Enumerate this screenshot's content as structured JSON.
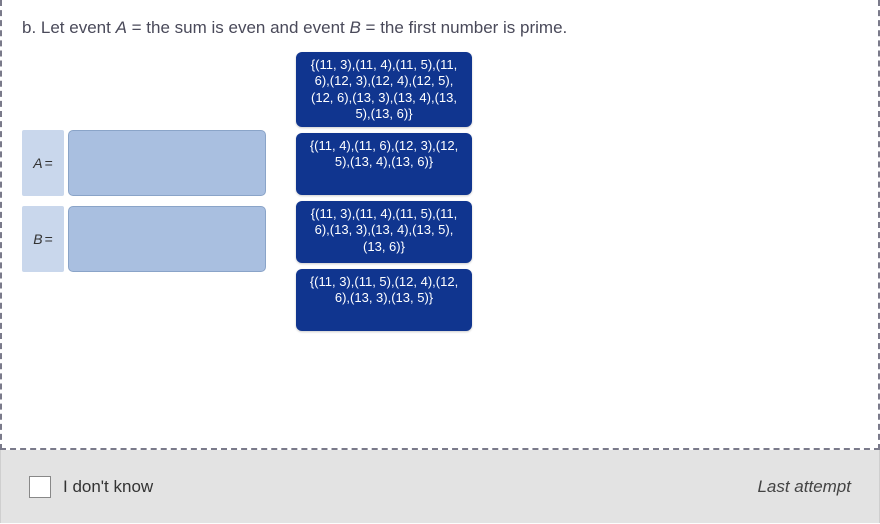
{
  "prompt": {
    "prefix": "b. Let event ",
    "a": "A",
    "mid1": " = the sum is even and event ",
    "b": "B",
    "mid2": " = the first number is prime."
  },
  "targets": {
    "a_label": "A",
    "b_label": "B",
    "eq": "="
  },
  "choices": [
    "{(11, 3),(11, 4),(11, 5),(11, 6),(12, 3),(12, 4),(12, 5),(12, 6),(13, 3),(13, 4),(13, 5),(13, 6)}",
    "{(11, 4),(11, 6),(12, 3),(12, 5),(13, 4),(13, 6)}",
    "{(11, 3),(11, 4),(11, 5),(11, 6),(13, 3),(13, 4),(13, 5),(13, 6)}",
    "{(11, 3),(11, 5),(12, 4),(12, 6),(13, 3),(13, 5)}"
  ],
  "footer": {
    "idk": "I don't know",
    "last": "Last attempt"
  }
}
